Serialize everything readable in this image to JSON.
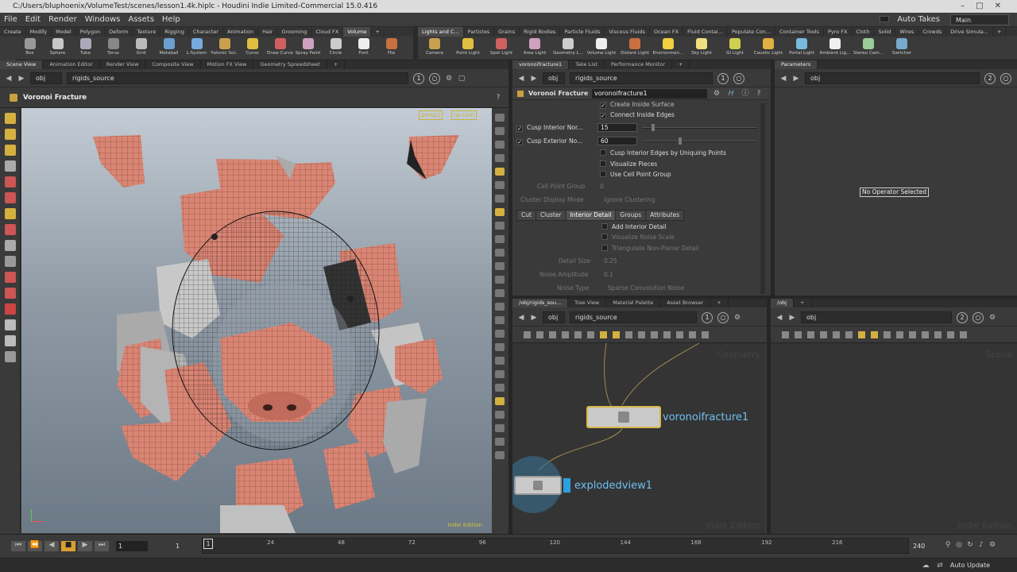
{
  "window": {
    "title": "C:/Users/bluphoenix/VolumeTest/scenes/lesson1.4k.hiplc - Houdini Indie Limited-Commercial 15.0.416"
  },
  "menu": {
    "items": [
      "File",
      "Edit",
      "Render",
      "Windows",
      "Assets",
      "Help"
    ],
    "auto_takes": "Auto Takes",
    "desktop": "Main"
  },
  "shelf_tabs_left": [
    "Create",
    "Modify",
    "Model",
    "Polygon",
    "Deform",
    "Texture",
    "Rigging",
    "Character",
    "Animation",
    "Hair",
    "Grooming",
    "Cloud FX",
    "Volume"
  ],
  "shelf_tabs_right": [
    "Lights and C...",
    "Particles",
    "Grains",
    "Rigid Bodies",
    "Particle Fluids",
    "Viscous Fluids",
    "Ocean FX",
    "Fluid Contai...",
    "Populate Con...",
    "Container Tools",
    "Pyro FX",
    "Cloth",
    "Solid",
    "Wires",
    "Crowds",
    "Drive Simula..."
  ],
  "shelf_tools_left": [
    "Box",
    "Sphere",
    "Tube",
    "Torus",
    "Grid",
    "Metaball",
    "L-System",
    "Platonic Sol...",
    "Curve",
    "Draw Curve",
    "Spray Paint",
    "Circle",
    "Font",
    "File"
  ],
  "shelf_tools_right": [
    "Camera",
    "Point Light",
    "Spot Light",
    "Area Light",
    "Geometry L...",
    "Volume Light",
    "Distant Light",
    "Environmen...",
    "Sky Light",
    "GI Light",
    "Caustic Light",
    "Portal Light",
    "Ambient Lig...",
    "Stereo Cam...",
    "Switcher"
  ],
  "viewer": {
    "tabs": [
      "Scene View",
      "Animation Editor",
      "Render View",
      "Composite View",
      "Motion FX View",
      "Geometry Spreadsheet"
    ],
    "path_root": "obj",
    "path_node": "rigids_source",
    "link_number": "1",
    "title": "Voronoi Fracture",
    "camera": "persp1",
    "cam_menu": "no cam",
    "watermark": "Indie Edition"
  },
  "params": {
    "tabs": [
      "voronoifracture1",
      "Take List",
      "Performance Monitor"
    ],
    "path_root": "obj",
    "path_node": "rigids_source",
    "link_number": "1",
    "node_type": "Voronoi Fracture",
    "node_name": "voronoifracture1",
    "create_inside_surface": "Create Inside Surface",
    "connect_inside_edges": "Connect Inside Edges",
    "cusp_interior_label": "Cusp Interior Nor...",
    "cusp_interior_value": "15",
    "cusp_exterior_label": "Cusp Exterior No...",
    "cusp_exterior_value": "60",
    "cusp_uniquing": "Cusp Interior Edges by Uniquing Points",
    "visualize_pieces": "Visualize Pieces",
    "use_cell_point_group": "Use Cell Point Group",
    "cell_point_group_label": "Cell Point Group",
    "cell_point_group_value": "0",
    "cluster_display_label": "Cluster Display Mode",
    "cluster_display_value": "Ignore Clustering",
    "subtabs": [
      "Cut",
      "Cluster",
      "Interior Detail",
      "Groups",
      "Attributes"
    ],
    "add_interior_detail": "Add Interior Detail",
    "visualize_noise_scale": "Visualize Noise Scale",
    "triangulate": "Triangulate Non-Planar Detail",
    "detail_size_label": "Detail Size",
    "detail_size_value": "0.25",
    "noise_amp_label": "Noise Amplitude",
    "noise_amp_value": "0.1",
    "noise_type_label": "Noise Type",
    "noise_type_value": "Sparse Convolution Noise"
  },
  "parameters_pane": {
    "tab": "Parameters",
    "path_root": "obj",
    "link_number": "2",
    "message": "No Operator Selected"
  },
  "network": {
    "tabs": [
      "/obj/rigids_sou...",
      "Tree View",
      "Material Palette",
      "Asset Browser"
    ],
    "path_root": "obj",
    "path_node": "rigids_source",
    "link_number": "1",
    "context_label": "Geometry",
    "watermark": "Indie Edition",
    "node1": "voronoifracture1",
    "node2": "explodedview1"
  },
  "network2": {
    "tab": "/obj",
    "path_root": "obj",
    "link_number": "2",
    "context_label": "Scene",
    "watermark": "Indie Edition"
  },
  "timeline": {
    "current_frame": "1",
    "start_frame": "1",
    "frame_marker": "1",
    "end_frame": "240",
    "ticks": [
      "24",
      "48",
      "72",
      "96",
      "120",
      "144",
      "168",
      "192",
      "216"
    ]
  },
  "status": {
    "auto_update": "Auto Update"
  },
  "colors": {
    "accent_node": "#d9b84a",
    "node_label": "#6fbff0",
    "skin": "#d98574"
  }
}
